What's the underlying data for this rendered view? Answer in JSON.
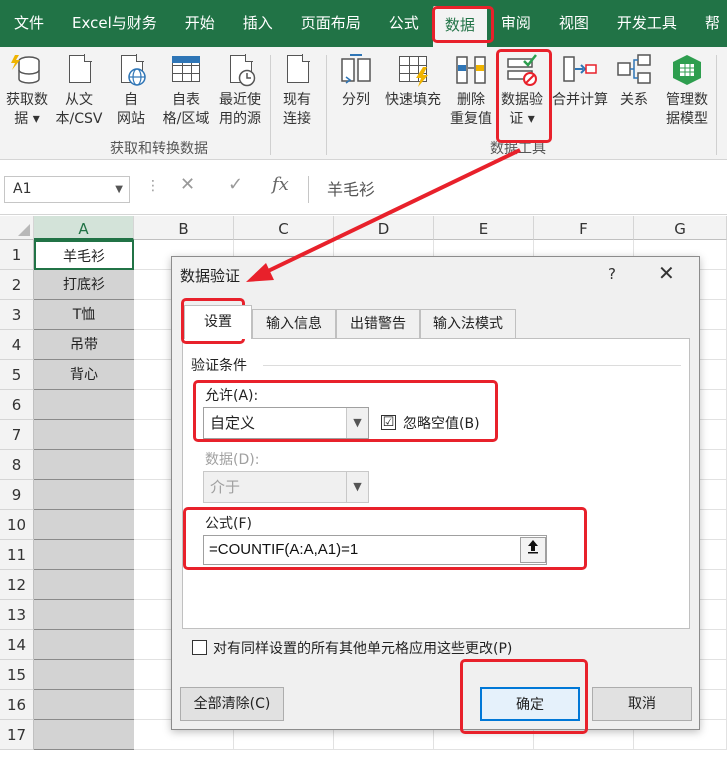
{
  "ribbon_tabs": [
    "文件",
    "Excel与财务",
    "开始",
    "插入",
    "页面布局",
    "公式",
    "数据",
    "审阅",
    "视图",
    "开发工具",
    "帮"
  ],
  "active_tab_index": 6,
  "ribbon": {
    "get_data": "获取数\n据 ▾",
    "from_text_csv": "从文\n本/CSV",
    "from_web": "自\n网站",
    "from_table": "自表\n格/区域",
    "recent_sources": "最近使\n用的源",
    "existing_connections": "现有\n连接",
    "group_get_transform": "获取和转换数据",
    "text_to_columns": "分列",
    "flash_fill": "快速填充",
    "remove_duplicates": "删除\n重复值",
    "data_validation": "数据验\n证 ▾",
    "consolidate": "合并计算",
    "relationships": "关系",
    "manage_data_model": "管理数\n据模型",
    "group_data_tools": "数据工具"
  },
  "formula_bar": {
    "name_box": "A1",
    "cancel_icon": "✕",
    "enter_icon": "✓",
    "fx_label": "fx",
    "formula": "羊毛衫"
  },
  "sheet": {
    "columns": [
      "A",
      "B",
      "C",
      "D",
      "E",
      "F",
      "G"
    ],
    "rows": [
      "1",
      "2",
      "3",
      "4",
      "5",
      "6",
      "7",
      "8",
      "9",
      "10",
      "11",
      "12",
      "13",
      "14",
      "15",
      "16",
      "17"
    ],
    "cells_a": [
      "羊毛衫",
      "打底衫",
      "T恤",
      "吊带",
      "背心"
    ]
  },
  "dialog": {
    "title": "数据验证",
    "help": "?",
    "close": "✕",
    "tabs": [
      "设置",
      "输入信息",
      "出错警告",
      "输入法模式"
    ],
    "section_label": "验证条件",
    "allow_label": "允许(A):",
    "allow_value": "自定义",
    "ignore_blank_label": "忽略空值(B)",
    "ignore_blank_checked": "☑",
    "data_label": "数据(D):",
    "data_value": "介于",
    "formula_label": "公式(F)",
    "formula_value": "=COUNTIF(A:A,A1)=1",
    "apply_all_label": "对有同样设置的所有其他单元格应用这些更改(P)",
    "clear_all": "全部清除(C)",
    "ok": "确定",
    "cancel": "取消"
  },
  "colors": {
    "excel_green": "#217346",
    "highlight_red": "#e8212b",
    "selected_col": "#d3e3d9"
  }
}
